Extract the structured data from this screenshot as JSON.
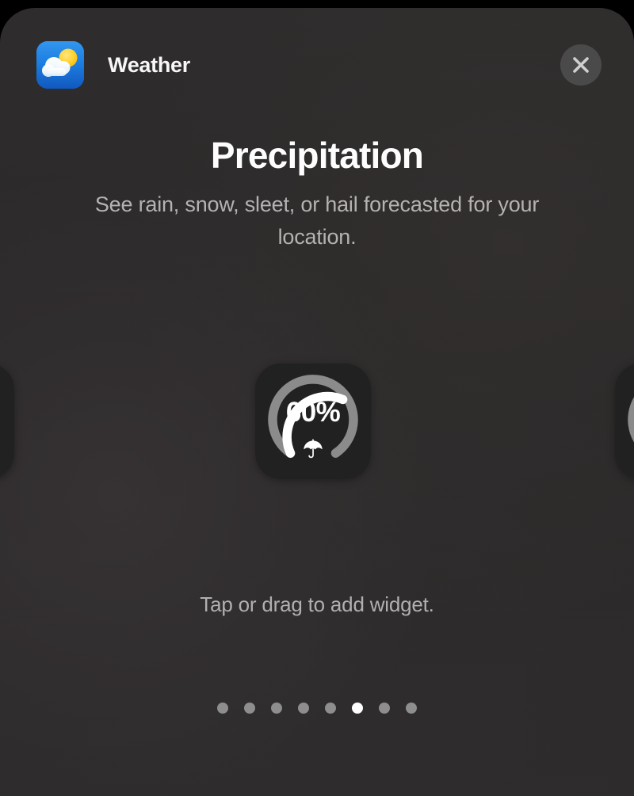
{
  "header": {
    "app_name": "Weather",
    "app_icon": "weather-partly-cloudy-icon",
    "close_label": "close-icon"
  },
  "widget": {
    "title": "Precipitation",
    "description": "See rain, snow, sleet, or hail forecasted for your location.",
    "preview": {
      "value_label": "60%",
      "value_percent": 60,
      "icon": "umbrella-icon",
      "tile_color": "#222121",
      "arc_filled_color": "#ffffff",
      "arc_track_color": "#8c8b8b"
    }
  },
  "hint": {
    "text": "Tap or drag to add widget."
  },
  "pagination": {
    "total": 8,
    "active_index": 5,
    "active_color": "#ffffff",
    "inactive_color": "#8e8e8e"
  },
  "theme": {
    "backdrop": "#000000",
    "sheet_background": "#2e2c2c",
    "title_color": "#fdfdfd",
    "secondary_text_color": "#b4b3b2",
    "close_button_background": "#4b4a4a"
  }
}
